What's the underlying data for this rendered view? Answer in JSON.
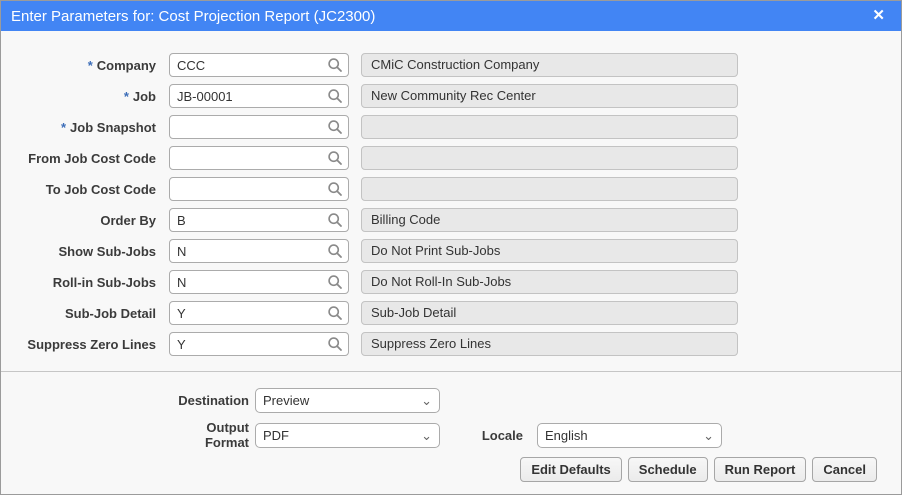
{
  "dialog": {
    "title": "Enter Parameters for: Cost Projection Report (JC2300)",
    "close_glyph": "✕"
  },
  "icons": {
    "search": "magnifier",
    "chevron_down": "⌄"
  },
  "colors": {
    "header_blue": "#4285f4",
    "required_asterisk_blue": "#3c6db8",
    "readonly_field_gray": "#e8e8e8"
  },
  "form": {
    "required_marker": "*",
    "rows": [
      {
        "label": "Company",
        "required": true,
        "value": "CCC",
        "description": "CMiC Construction Company"
      },
      {
        "label": "Job",
        "required": true,
        "value": "JB-00001",
        "description": "New Community Rec Center"
      },
      {
        "label": "Job Snapshot",
        "required": true,
        "value": "",
        "description": ""
      },
      {
        "label": "From Job Cost Code",
        "required": false,
        "value": "",
        "description": ""
      },
      {
        "label": "To Job Cost Code",
        "required": false,
        "value": "",
        "description": ""
      },
      {
        "label": "Order By",
        "required": false,
        "value": "B",
        "description": "Billing Code"
      },
      {
        "label": "Show Sub-Jobs",
        "required": false,
        "value": "N",
        "description": "Do Not Print Sub-Jobs"
      },
      {
        "label": "Roll-in Sub-Jobs",
        "required": false,
        "value": "N",
        "description": "Do Not Roll-In Sub-Jobs"
      },
      {
        "label": "Sub-Job Detail",
        "required": false,
        "value": "Y",
        "description": "Sub-Job Detail"
      },
      {
        "label": "Suppress Zero Lines",
        "required": false,
        "value": "Y",
        "description": "Suppress Zero Lines"
      }
    ]
  },
  "output_options": {
    "destination": {
      "label": "Destination",
      "value": "Preview"
    },
    "output_format": {
      "label": "Output Format",
      "value": "PDF"
    },
    "locale": {
      "label": "Locale",
      "value": "English"
    }
  },
  "footer_buttons": {
    "edit_defaults": "Edit Defaults",
    "schedule": "Schedule",
    "run_report": "Run Report",
    "cancel": "Cancel"
  }
}
